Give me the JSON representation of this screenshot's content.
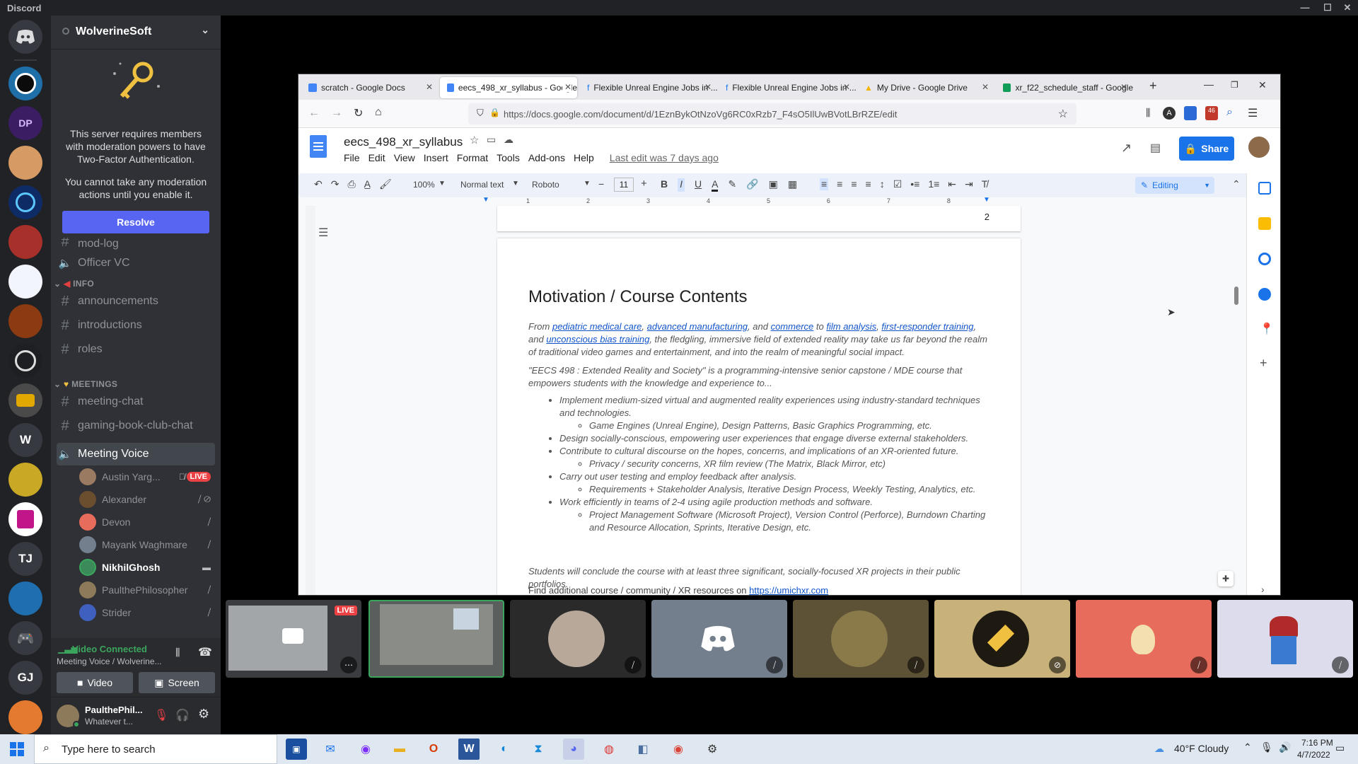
{
  "window": {
    "title": "Discord"
  },
  "server": {
    "name": "WolverineSoft",
    "notice": {
      "line1": "This server requires members with moderation powers to have Two-Factor Authentication.",
      "line2": "You cannot take any moderation actions until you enable it.",
      "button": "Resolve"
    },
    "cut_channel": "mod-log",
    "officer": "Officer VC",
    "cat_info": "INFO",
    "info_channels": [
      "announcements",
      "introductions",
      "roles"
    ],
    "cat_meetings": "MEETINGS",
    "meeting_channels": [
      "meeting-chat",
      "gaming-book-club-chat"
    ],
    "voice_channel": "Meeting Voice",
    "voice_users": [
      {
        "name": "Austin Yarg...",
        "badge": "LIVE"
      },
      {
        "name": "Alexander"
      },
      {
        "name": "Devon"
      },
      {
        "name": "Mayank Waghmare"
      },
      {
        "name": "NikhilGhosh"
      },
      {
        "name": "PaulthePhilosopher"
      },
      {
        "name": "Strider"
      }
    ],
    "rail_letters": [
      "W",
      "TJ",
      "GJ"
    ]
  },
  "voice": {
    "status": "Video Connected",
    "channel": "Meeting Voice / Wolverine...",
    "video_btn": "Video",
    "screen_btn": "Screen"
  },
  "user": {
    "name": "PaulthePhil...",
    "status": "Whatever t..."
  },
  "browser": {
    "tabs": [
      {
        "title": "scratch - Google Docs"
      },
      {
        "title": "eecs_498_xr_syllabus - Google"
      },
      {
        "title": "Flexible Unreal Engine Jobs in ..."
      },
      {
        "title": "Flexible Unreal Engine Jobs in ..."
      },
      {
        "title": "My Drive - Google Drive"
      },
      {
        "title": "xr_f22_schedule_staff - Google"
      }
    ],
    "url": "https://docs.google.com/document/d/1EznBykOtNzoVg6RC0xRzb7_F4sO5IlUwBVotLBrRZE/edit",
    "badge_count": "46"
  },
  "doc": {
    "title": "eecs_498_xr_syllabus",
    "menus": [
      "File",
      "Edit",
      "View",
      "Insert",
      "Format",
      "Tools",
      "Add-ons",
      "Help"
    ],
    "last_edit": "Last edit was 7 days ago",
    "share": "Share",
    "zoom": "100%",
    "style": "Normal text",
    "font": "Roboto",
    "size": "11",
    "mode": "Editing",
    "ruler_nums": [
      "1",
      "2",
      "3",
      "4",
      "5",
      "6",
      "7",
      "8"
    ],
    "page_num": "2",
    "heading": "Motivation / Course Contents",
    "p1": {
      "pre": "From",
      "l1": "pediatric medical care",
      "l2": "advanced manufacturing",
      "and1": ", and",
      "l3": "commerce",
      "to": "to",
      "l4": "film analysis",
      "l5": "first-responder training",
      "and2": ", and",
      "l6": "unconscious bias training",
      "rest": ", the fledgling, immersive field of extended reality may take us far beyond the realm of traditional video games and entertainment, and into the realm of meaningful social impact."
    },
    "p2": "\"EECS 498 : Extended Reality and Society\" is a programming-intensive senior capstone / MDE course that empowers students with the knowledge and experience to...",
    "bullets": [
      {
        "t": "Implement medium-sized virtual and augmented reality experiences using industry-standard techniques and technologies.",
        "sub": "Game Engines (Unreal Engine), Design Patterns, Basic Graphics Programming, etc."
      },
      {
        "t": "Design socially-conscious, empowering user experiences that engage diverse external stakeholders.",
        "sub": ""
      },
      {
        "t": "Contribute to cultural discourse on the hopes, concerns, and implications of an XR-oriented future.",
        "sub": "Privacy / security concerns, XR film review (The Matrix, Black Mirror, etc)"
      },
      {
        "t": "Carry out user testing and employ feedback after analysis.",
        "sub": "Requirements + Stakeholder Analysis, Iterative Design Process, Weekly Testing, Analytics, etc."
      },
      {
        "t": "Work efficiently in teams of 2-4 using agile production methods and software.",
        "sub": "Project Management Software (Microsoft Project), Version Control (Perforce), Burndown Charting and Resource Allocation, Sprints, Iterative Design, etc."
      }
    ],
    "p3": "Students will conclude the course with at least three significant, socially-focused XR projects in their public portfolios.",
    "p4_pre": "Find additional course / community / XR resources on",
    "p4_link": "https://umichxr.com"
  },
  "tiles": {
    "live": "LIVE"
  },
  "taskbar": {
    "search": "Type here to search",
    "weather": "40°F  Cloudy",
    "time": "7:16 PM",
    "date": "4/7/2022"
  }
}
